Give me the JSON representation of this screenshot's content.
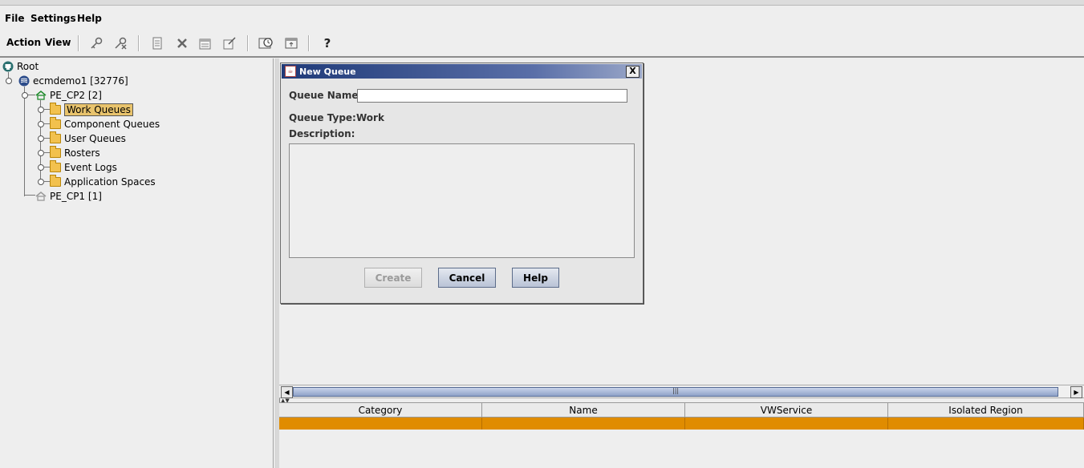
{
  "menu": {
    "file": "File",
    "settings": "Settings",
    "help": "Help"
  },
  "toolbar": {
    "action": "Action",
    "view": "View",
    "help_glyph": "?"
  },
  "tree": {
    "root": "Root",
    "server": "ecmdemo1 [32776]",
    "conn1": "PE_CP2 [2]",
    "items": [
      "Work Queues",
      "Component Queues",
      "User Queues",
      "Rosters",
      "Event Logs",
      "Application Spaces"
    ],
    "conn2": "PE_CP1 [1]"
  },
  "dialog": {
    "title": "New Queue",
    "close_glyph": "X",
    "queue_name_label": "Queue Name:",
    "queue_name_value": "",
    "queue_type_label": "Queue Type:",
    "queue_type_value": "Work",
    "description_label": "Description:",
    "description_value": "",
    "create": "Create",
    "cancel": "Cancel",
    "help": "Help"
  },
  "table": {
    "columns": [
      "Category",
      "Name",
      "VWService",
      "Isolated Region"
    ]
  }
}
